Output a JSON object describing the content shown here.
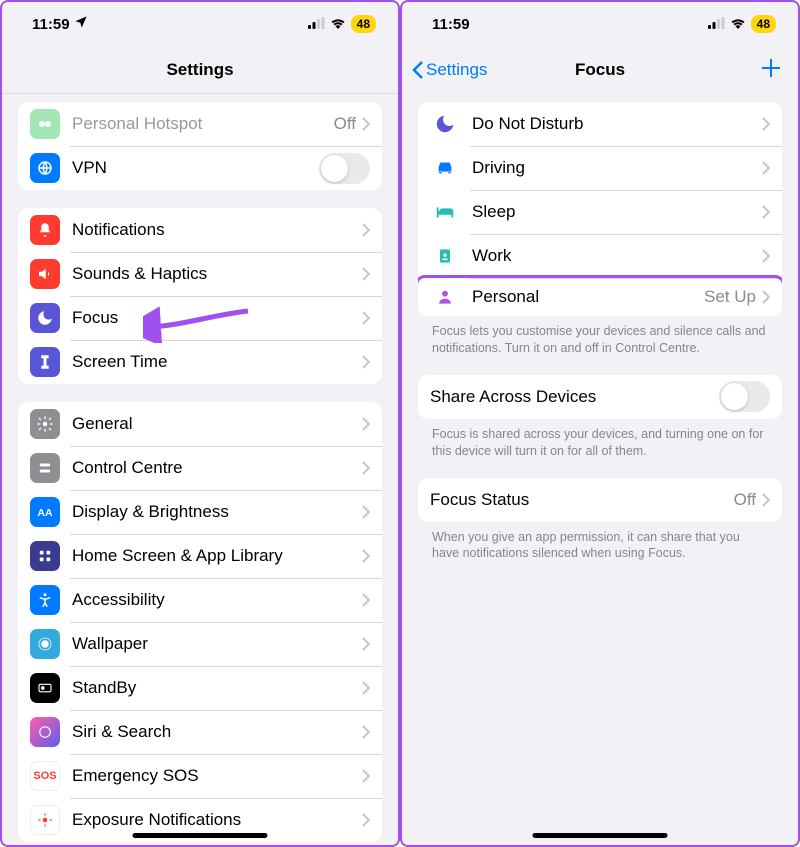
{
  "status": {
    "time": "11:59",
    "battery": "48"
  },
  "left": {
    "nav_title": "Settings",
    "group1": [
      {
        "label": "Personal Hotspot",
        "detail": "Off",
        "dim": true
      },
      {
        "label": "VPN"
      }
    ],
    "group2": [
      {
        "label": "Notifications"
      },
      {
        "label": "Sounds & Haptics"
      },
      {
        "label": "Focus"
      },
      {
        "label": "Screen Time"
      }
    ],
    "group3": [
      {
        "label": "General"
      },
      {
        "label": "Control Centre"
      },
      {
        "label": "Display & Brightness"
      },
      {
        "label": "Home Screen & App Library"
      },
      {
        "label": "Accessibility"
      },
      {
        "label": "Wallpaper"
      },
      {
        "label": "StandBy"
      },
      {
        "label": "Siri & Search"
      },
      {
        "label": "Emergency SOS"
      },
      {
        "label": "Exposure Notifications"
      }
    ]
  },
  "right": {
    "back_label": "Settings",
    "nav_title": "Focus",
    "modes": [
      {
        "label": "Do Not Disturb"
      },
      {
        "label": "Driving"
      },
      {
        "label": "Sleep"
      },
      {
        "label": "Work"
      },
      {
        "label": "Personal",
        "detail": "Set Up",
        "highlight": true
      }
    ],
    "modes_footer": "Focus lets you customise your devices and silence calls and notifications. Turn it on and off in Control Centre.",
    "share_label": "Share Across Devices",
    "share_footer": "Focus is shared across your devices, and turning one on for this device will turn it on for all of them.",
    "status_label": "Focus Status",
    "status_detail": "Off",
    "status_footer": "When you give an app permission, it can share that you have notifications silenced when using Focus."
  }
}
